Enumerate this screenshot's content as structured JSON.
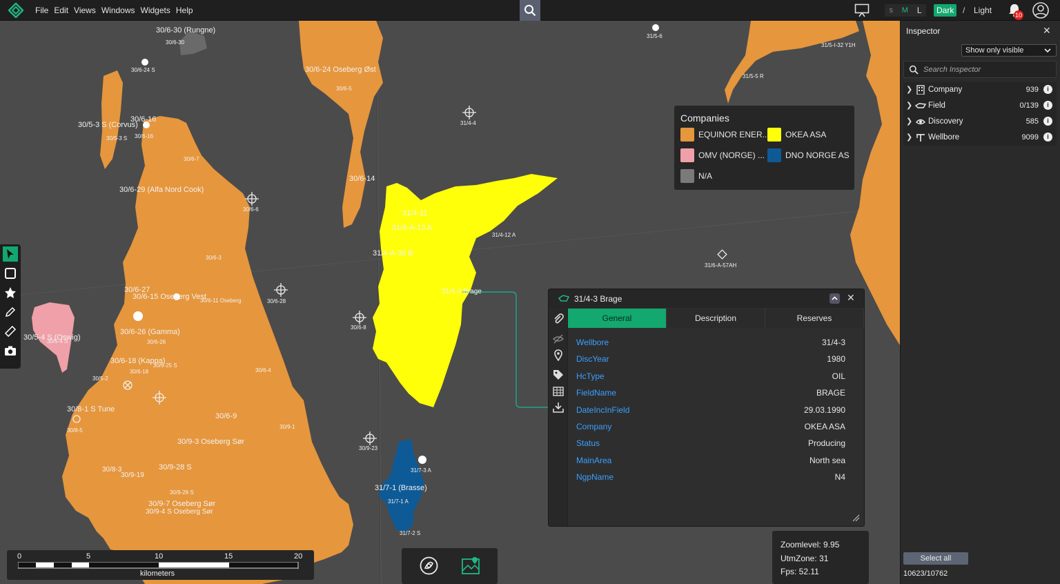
{
  "menu": [
    "File",
    "Edit",
    "Views",
    "Windows",
    "Widgets",
    "Help"
  ],
  "topbar": {
    "size_options": [
      "S",
      "M",
      "L"
    ],
    "theme_dark": "Dark",
    "theme_sep": "/",
    "theme_light": "Light",
    "notification_count": "10"
  },
  "colors": {
    "accent": "#12a86f",
    "equinor": "#e6963c",
    "okea": "#ffff0a",
    "omv": "#f0a0a8",
    "dno": "#0e5a96",
    "na": "#7a7a7a",
    "link": "#3aa0ff"
  },
  "legend": {
    "title": "Companies",
    "items": [
      {
        "name": "EQUINOR ENER...",
        "color": "#e6963c"
      },
      {
        "name": "OKEA ASA",
        "color": "#ffff0a"
      },
      {
        "name": "OMV (NORGE) ...",
        "color": "#f0a0a8"
      },
      {
        "name": "DNO NORGE AS",
        "color": "#0e5a96"
      },
      {
        "name": "N/A",
        "color": "#7a7a7a"
      }
    ]
  },
  "map_labels": {
    "rungne": "30/6-30 (Rungne)",
    "l_30_6_30": "30/6-30",
    "l_30_6_24s": "30/6-24 S",
    "oseberg_ost": "30/6-24 Oseberg Øst",
    "l_30_6_5": "30/6-5",
    "corvus": "30/5-3 S (Corvus)",
    "l_30_6_16": "30/6-16",
    "l_30_5_3s": "30/5-3 S",
    "l_30_6_16b": "30/6-16",
    "l_30_6_7": "30/6-7",
    "alfa": "30/6-29 (Alfa Nord Cook)",
    "l_30_6_6": "30/6-6",
    "l_30_6_3": "30/6-3",
    "l_30_6_27": "30/6-27",
    "l_30_6_15": "30/6-15 Oseberg Vest",
    "l_30_6_28": "30/6-28",
    "l_30_6_11": "30/6-11 Oseberg",
    "l_30_6_26": "30/6-26 (Gamma)",
    "l_30_6_26b": "30/6-26",
    "l_30_6_25s": "30/6-25 S",
    "oswig": "30/5-4 S (Oswig)",
    "l_30_5_4s": "30/5-4 S",
    "kappa": "30/6-18 (Kappa)",
    "l_30_6_18": "30/6-18",
    "l_30_6_4": "30/6-4",
    "l_30_5_2": "30/5-2",
    "tune": "30/8-1 S Tune",
    "l_30_8_5": "30/8-5",
    "l_30_6_9": "30/6-9",
    "l_30_9_1": "30/9-1",
    "oseberg_sor": "30/9-3 Oseberg Sør",
    "l_30_8_3": "30/8-3",
    "l_30_9_19": "30/9-19",
    "l_30_9_28s": "30/9-28 S",
    "l_30_9_28s_b": "30/9-28 S",
    "l_30_9_7": "30/9-7 Oseberg Sør",
    "l_30_9_4s": "30/9-4 S Oseberg Sør",
    "l_31_4_4": "31/4-4",
    "l_31_4_11": "31/4-11",
    "l_31_4_a_13a": "31/4-A-13 A",
    "l_31_4_a_30b": "31/4-A-30 B",
    "l_31_4_12a": "31/4-12 A",
    "l_31_4_3_brage": "31/4-3 Brage",
    "l_30_6_14": "30/6-14",
    "l_30_6_8": "30/6-8",
    "l_30_9_23": "30/9-23",
    "brasse": "31/7-1 (Brasse)",
    "l_31_7_1a": "31/7-1 A",
    "l_31_7_3a": "31/7-3 A",
    "l_31_7_2s": "31/7-2 S",
    "l_31_5_6": "31/5-6",
    "l_31_5_5r": "31/5-5 R",
    "l_31_5_32": "31/5-I-32 Y1H",
    "l_31_6_a5": "31/6-A-57AH"
  },
  "info_panel": {
    "title": "31/4-3 Brage",
    "tabs": [
      "General",
      "Description",
      "Reserves"
    ],
    "rows": [
      {
        "k": "Wellbore",
        "v": "31/4-3"
      },
      {
        "k": "DiscYear",
        "v": "1980"
      },
      {
        "k": "HcType",
        "v": "OIL"
      },
      {
        "k": "FieldName",
        "v": "BRAGE"
      },
      {
        "k": "DateIncInField",
        "v": "29.03.1990"
      },
      {
        "k": "Company",
        "v": "OKEA ASA"
      },
      {
        "k": "Status",
        "v": "Producing"
      },
      {
        "k": "MainArea",
        "v": "North sea"
      },
      {
        "k": "NgpName",
        "v": "N4"
      }
    ]
  },
  "scale": {
    "ticks": [
      "0",
      "5",
      "10",
      "15",
      "20"
    ],
    "unit": "kilometers"
  },
  "status": {
    "zoom": "Zoomlevel: 9.95",
    "utm": "UtmZone: 31",
    "fps": "Fps: 52.11"
  },
  "inspector": {
    "title": "Inspector",
    "filter": "Show only visible",
    "search_placeholder": "Search Inspector",
    "tree": [
      {
        "label": "Company",
        "count": "939",
        "icon": "building-icon"
      },
      {
        "label": "Field",
        "count": "0/139",
        "icon": "field-icon"
      },
      {
        "label": "Discovery",
        "count": "585",
        "icon": "discovery-icon"
      },
      {
        "label": "Wellbore",
        "count": "9099",
        "icon": "wellbore-icon"
      }
    ],
    "select_all": "Select all",
    "count": "10623/10762"
  }
}
